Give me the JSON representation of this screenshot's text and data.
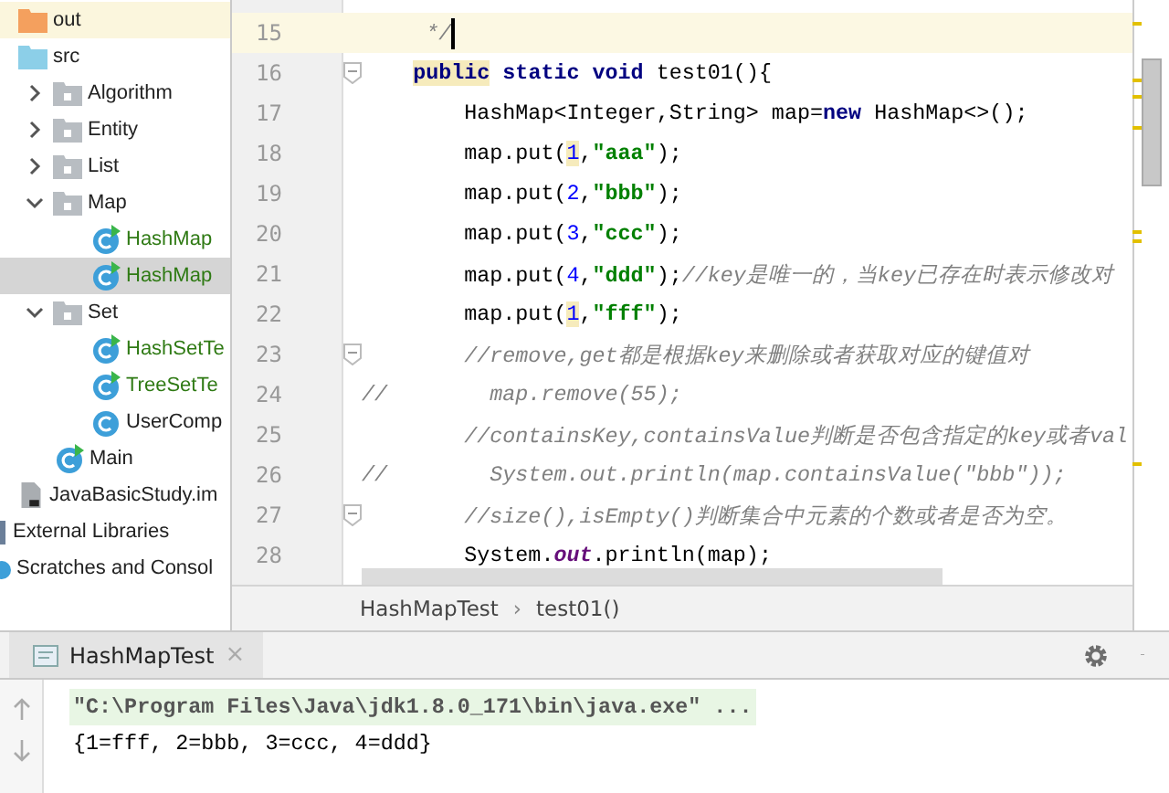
{
  "project_tree": [
    {
      "label": "out",
      "kind": "excluded-folder",
      "selected": false
    },
    {
      "label": "src",
      "kind": "source-folder",
      "selected": false,
      "children": [
        {
          "label": "Algorithm",
          "kind": "package",
          "selected": false,
          "expanded": false
        },
        {
          "label": "Entity",
          "kind": "package",
          "selected": false,
          "expanded": false
        },
        {
          "label": "List",
          "kind": "package",
          "selected": false,
          "expanded": false
        },
        {
          "label": "Map",
          "kind": "package",
          "selected": false,
          "expanded": true,
          "children": [
            {
              "label": "HashMap",
              "kind": "runnable-class",
              "selected": false
            },
            {
              "label": "HashMap",
              "kind": "runnable-class",
              "selected": true
            }
          ]
        },
        {
          "label": "Set",
          "kind": "package",
          "selected": false,
          "expanded": true,
          "children": [
            {
              "label": "HashSetTe",
              "kind": "runnable-class",
              "selected": false
            },
            {
              "label": "TreeSetTe",
              "kind": "runnable-class",
              "selected": false
            },
            {
              "label": "UserComp",
              "kind": "class",
              "selected": false
            }
          ]
        },
        {
          "label": "Main",
          "kind": "runnable-class",
          "selected": false
        }
      ]
    },
    {
      "label": "JavaBasicStudy.im",
      "kind": "module-file",
      "selected": false
    },
    {
      "label": "External Libraries",
      "kind": "libraries",
      "selected": false
    },
    {
      "label": "Scratches and Consol",
      "kind": "scratches",
      "selected": false
    }
  ],
  "editor": {
    "lines": [
      {
        "number": "15",
        "current": true,
        "fold": false,
        "tokens": [
          {
            "kind": "comment",
            "text": "     */"
          }
        ]
      },
      {
        "number": "16",
        "current": false,
        "fold": true,
        "tokens": [
          {
            "kind": "kw-hl",
            "text": "    public"
          },
          {
            "kind": "kw",
            "text": " static void"
          },
          {
            "kind": "plain",
            "text": " test01(){"
          }
        ]
      },
      {
        "number": "17",
        "current": false,
        "fold": false,
        "tokens": [
          {
            "kind": "plain",
            "text": "        HashMap<Integer,String> map="
          },
          {
            "kind": "kw",
            "text": "new"
          },
          {
            "kind": "plain",
            "text": " HashMap<>();"
          }
        ]
      },
      {
        "number": "18",
        "current": false,
        "fold": false,
        "tokens": [
          {
            "kind": "plain",
            "text": "        map.put("
          },
          {
            "kind": "num-hl",
            "text": "1"
          },
          {
            "kind": "plain",
            "text": ","
          },
          {
            "kind": "str",
            "text": "\"aaa\""
          },
          {
            "kind": "plain",
            "text": ");"
          }
        ]
      },
      {
        "number": "19",
        "current": false,
        "fold": false,
        "tokens": [
          {
            "kind": "plain",
            "text": "        map.put("
          },
          {
            "kind": "num",
            "text": "2"
          },
          {
            "kind": "plain",
            "text": ","
          },
          {
            "kind": "str",
            "text": "\"bbb\""
          },
          {
            "kind": "plain",
            "text": ");"
          }
        ]
      },
      {
        "number": "20",
        "current": false,
        "fold": false,
        "tokens": [
          {
            "kind": "plain",
            "text": "        map.put("
          },
          {
            "kind": "num",
            "text": "3"
          },
          {
            "kind": "plain",
            "text": ","
          },
          {
            "kind": "str",
            "text": "\"ccc\""
          },
          {
            "kind": "plain",
            "text": ");"
          }
        ]
      },
      {
        "number": "21",
        "current": false,
        "fold": false,
        "tokens": [
          {
            "kind": "plain",
            "text": "        map.put("
          },
          {
            "kind": "num",
            "text": "4"
          },
          {
            "kind": "plain",
            "text": ","
          },
          {
            "kind": "str",
            "text": "\"ddd\""
          },
          {
            "kind": "plain",
            "text": ");"
          },
          {
            "kind": "comment",
            "text": "//key是唯一的，当key已存在时表示修改对"
          }
        ]
      },
      {
        "number": "22",
        "current": false,
        "fold": false,
        "tokens": [
          {
            "kind": "plain",
            "text": "        map.put("
          },
          {
            "kind": "num-hl",
            "text": "1"
          },
          {
            "kind": "plain",
            "text": ","
          },
          {
            "kind": "str",
            "text": "\"fff\""
          },
          {
            "kind": "plain",
            "text": ");"
          }
        ]
      },
      {
        "number": "23",
        "current": false,
        "fold": true,
        "tokens": [
          {
            "kind": "comment",
            "text": "        //remove,get都是根据key来删除或者获取对应的键值对"
          }
        ]
      },
      {
        "number": "24",
        "current": false,
        "fold": false,
        "tokens": [
          {
            "kind": "comment",
            "text": "//        map.remove(55);"
          }
        ]
      },
      {
        "number": "25",
        "current": false,
        "fold": false,
        "tokens": [
          {
            "kind": "comment",
            "text": "        //containsKey,containsValue判断是否包含指定的key或者val"
          }
        ]
      },
      {
        "number": "26",
        "current": false,
        "fold": false,
        "tokens": [
          {
            "kind": "comment",
            "text": "//        System.out.println(map.containsValue(\"bbb\"));"
          }
        ]
      },
      {
        "number": "27",
        "current": false,
        "fold": true,
        "tokens": [
          {
            "kind": "comment",
            "text": "        //size(),isEmpty()判断集合中元素的个数或者是否为空。"
          }
        ]
      },
      {
        "number": "28",
        "current": false,
        "fold": false,
        "tokens": [
          {
            "kind": "plain",
            "text": "        System."
          },
          {
            "kind": "field",
            "text": "out"
          },
          {
            "kind": "plain",
            "text": ".println(map);"
          }
        ]
      }
    ]
  },
  "breadcrumb": [
    "HashMapTest",
    "›",
    "test01()"
  ],
  "run_panel": {
    "tab": {
      "label": "HashMapTest",
      "close": "×"
    },
    "console": [
      {
        "kind": "command",
        "text": "\"C:\\Program Files\\Java\\jdk1.8.0_171\\bin\\java.exe\" ..."
      },
      {
        "kind": "output",
        "text": "{1=fff, 2=bbb, 3=ccc, 4=ddd}"
      }
    ]
  }
}
